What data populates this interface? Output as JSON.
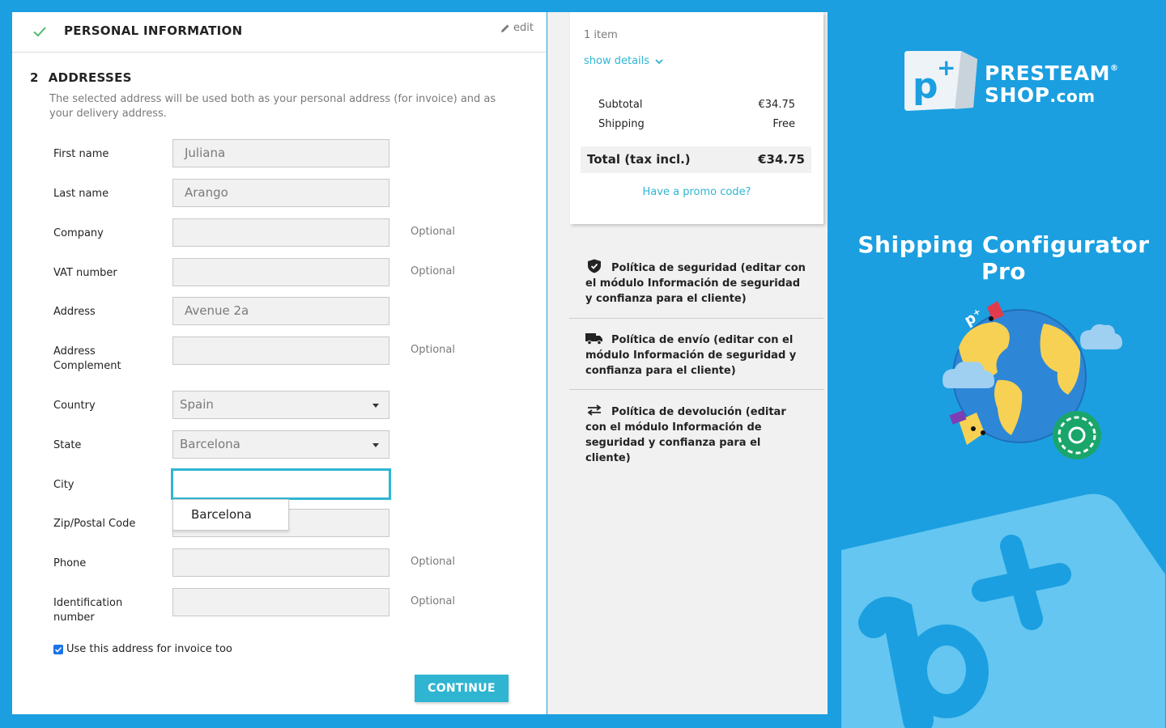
{
  "personal_info": {
    "title": "PERSONAL INFORMATION",
    "edit_label": "edit"
  },
  "addresses": {
    "step_number": "2",
    "title": "ADDRESSES",
    "description": "The selected address will be used both as your personal address (for invoice) and as your delivery address.",
    "optional_label": "Optional",
    "fields": {
      "first_name": {
        "label": "First name",
        "value": "Juliana"
      },
      "last_name": {
        "label": "Last name",
        "value": "Arango"
      },
      "company": {
        "label": "Company",
        "value": ""
      },
      "vat_number": {
        "label": "VAT number",
        "value": ""
      },
      "address": {
        "label": "Address",
        "value": "Avenue 2a"
      },
      "address_complement": {
        "label": "Address Complement",
        "value": ""
      },
      "country": {
        "label": "Country",
        "value": "Spain"
      },
      "state": {
        "label": "State",
        "value": "Barcelona"
      },
      "city": {
        "label": "City",
        "value": ""
      },
      "zip": {
        "label": "Zip/Postal Code",
        "value": ""
      },
      "phone": {
        "label": "Phone",
        "value": ""
      },
      "identification": {
        "label": "Identification number",
        "value": ""
      }
    },
    "city_suggestion": "Barcelona",
    "use_for_invoice_label": "Use this address for invoice too",
    "use_for_invoice_checked": true,
    "continue_label": "CONTINUE"
  },
  "cart": {
    "item_count": "1 item",
    "show_details": "show details",
    "subtotal_label": "Subtotal",
    "subtotal_value": "€34.75",
    "shipping_label": "Shipping",
    "shipping_value": "Free",
    "total_label": "Total (tax incl.)",
    "total_value": "€34.75",
    "promo_label": "Have a promo code?"
  },
  "reassurance": [
    {
      "icon": "shield-icon",
      "text": "Política de seguridad (editar con el módulo Información de seguridad y confianza para el cliente)"
    },
    {
      "icon": "truck-icon",
      "text": "Política de envío (editar con el módulo Información de seguridad y confianza para el cliente)"
    },
    {
      "icon": "swap-arrows-icon",
      "text": "Política de devolución (editar con el módulo Información de seguridad y confianza para el cliente)"
    }
  ],
  "banner": {
    "brand_line1": "PRESTEAM",
    "brand_line2": "SHOP",
    "brand_suffix": ".com",
    "registered_mark": "®",
    "product_title": "Shipping Configurator Pro"
  },
  "colors": {
    "accent": "#2fb5d2",
    "banner_blue": "#1b9fe0",
    "light_blue": "#64c6f1",
    "panel_gray": "#f1f1f1"
  }
}
